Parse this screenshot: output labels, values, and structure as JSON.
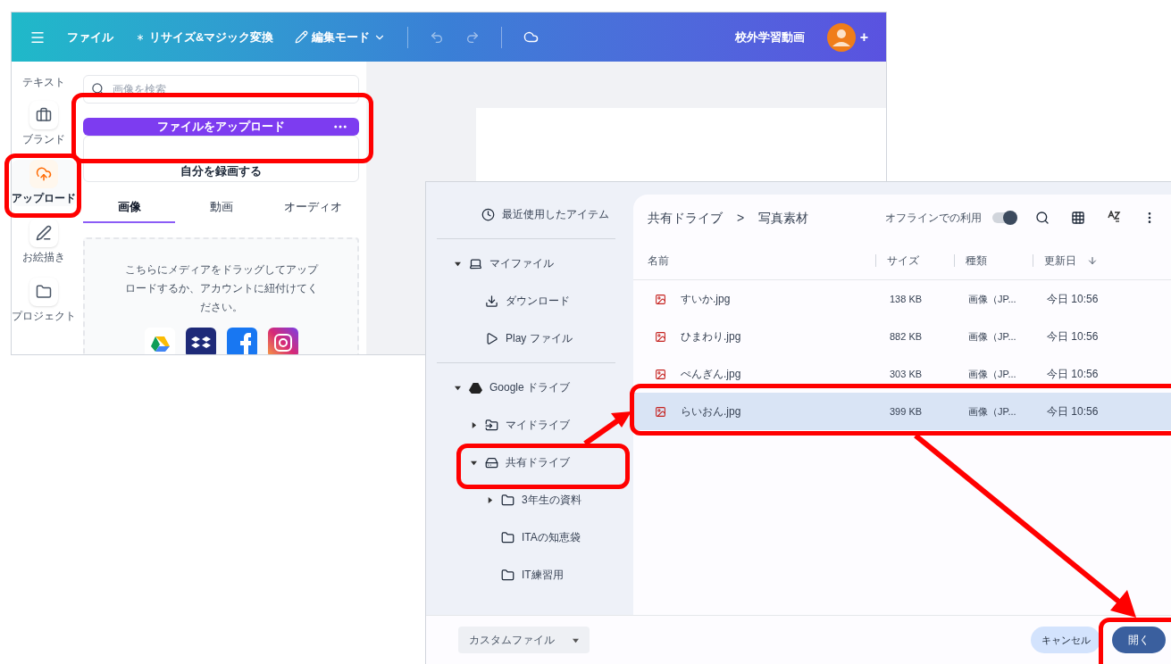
{
  "editor": {
    "toolbar": {
      "file_menu": "ファイル",
      "resize": "リサイズ&マジック変換",
      "mode": "編集モード",
      "title": "校外学習動画",
      "plus": "+"
    },
    "rail": [
      {
        "label": "テキスト",
        "kind": "text",
        "selected": false
      },
      {
        "label": "ブランド",
        "kind": "brand",
        "selected": false
      },
      {
        "label": "アップロード",
        "kind": "upload",
        "selected": true
      },
      {
        "label": "お絵描き",
        "kind": "draw",
        "selected": false
      },
      {
        "label": "プロジェクト",
        "kind": "project",
        "selected": false
      }
    ],
    "search": {
      "placeholder": "画像を検索"
    },
    "upload_button": "ファイルをアップロード",
    "record_button": "自分を録画する",
    "tabs": [
      {
        "label": "画像",
        "selected": true
      },
      {
        "label": "動画",
        "selected": false
      },
      {
        "label": "オーディオ",
        "selected": false
      }
    ],
    "drop_text": "こちらにメディアをドラッグしてアップロードするか、アカウントに紐付けてください。"
  },
  "file_dialog": {
    "sidebar": [
      {
        "label": "最近使用したアイテム",
        "kind": "recent"
      },
      {
        "label": "マイファイル",
        "kind": "device",
        "expanded": true,
        "children": [
          {
            "label": "ダウンロード",
            "kind": "download"
          },
          {
            "label": "Play ファイル",
            "kind": "play"
          }
        ]
      },
      {
        "label": "Google ドライブ",
        "kind": "drive",
        "expanded": true,
        "children": [
          {
            "label": "マイドライブ",
            "kind": "mydrive",
            "expanded": false
          },
          {
            "label": "共有ドライブ",
            "kind": "shared",
            "expanded": true,
            "children": [
              {
                "label": "3年生の資料",
                "kind": "folder",
                "expanded": false
              },
              {
                "label": "ITAの知恵袋",
                "kind": "folder"
              },
              {
                "label": "IT練習用",
                "kind": "folder"
              }
            ]
          }
        ]
      }
    ],
    "breadcrumb": [
      "共有ドライブ",
      "写真素材"
    ],
    "breadcrumb_separator": ">",
    "offline": {
      "label": "オフラインでの利用",
      "on": true
    },
    "columns": [
      "名前",
      "サイズ",
      "種類",
      "更新日"
    ],
    "rows": [
      {
        "name": "すいか.jpg",
        "size": "138 KB",
        "type": "画像（JP...",
        "modified": "今日 10:56",
        "selected": false
      },
      {
        "name": "ひまわり.jpg",
        "size": "882 KB",
        "type": "画像（JP...",
        "modified": "今日 10:56",
        "selected": false
      },
      {
        "name": "ぺんぎん.jpg",
        "size": "303 KB",
        "type": "画像（JP...",
        "modified": "今日 10:56",
        "selected": false
      },
      {
        "name": "らいおん.jpg",
        "size": "399 KB",
        "type": "画像（JP...",
        "modified": "今日 10:56",
        "selected": true
      }
    ],
    "file_type": "カスタムファイル",
    "cancel_button": "キャンセル",
    "open_button": "開く"
  }
}
